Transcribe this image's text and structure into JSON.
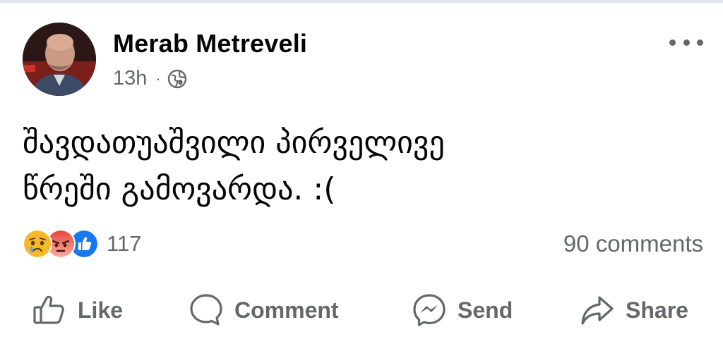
{
  "post": {
    "author": "Merab Metreveli",
    "time": "13h",
    "separator": "·",
    "privacy_icon": "globe-icon",
    "text_line1": "შავდათუაშვილი პირველივე",
    "text_line2": "წრეში გამოვარდა. :("
  },
  "reactions": {
    "types": [
      "sad",
      "angry",
      "like"
    ],
    "count": "117"
  },
  "comments": {
    "label": "90 comments"
  },
  "actions": {
    "like": "Like",
    "comment": "Comment",
    "send": "Send",
    "share": "Share"
  },
  "colors": {
    "text": "#050505",
    "secondary": "#65676b",
    "like_blue": "#1877f2",
    "angry": "#f06a3b",
    "sad": "#f7b928"
  }
}
